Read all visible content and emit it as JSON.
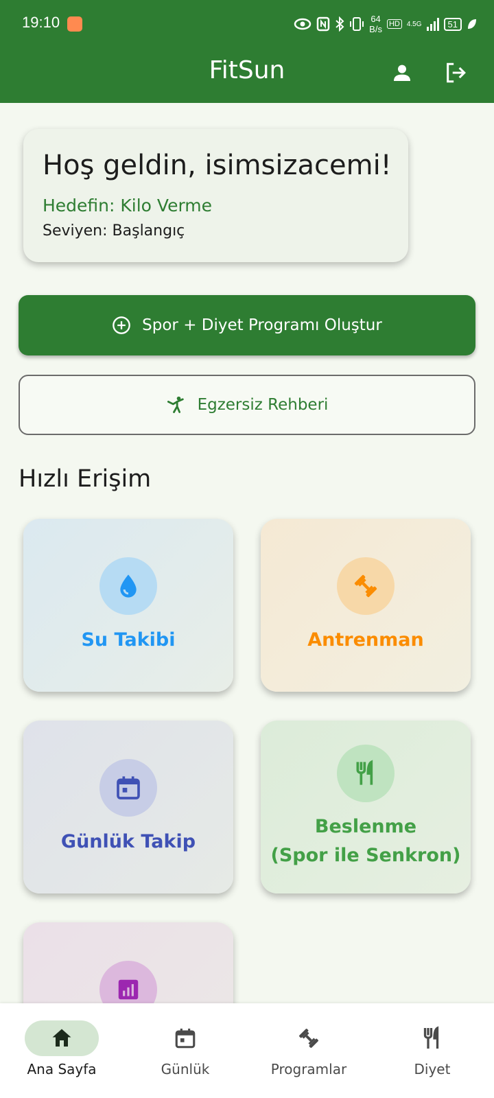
{
  "status_bar": {
    "time": "19:10",
    "net_speed_value": "64",
    "net_speed_unit": "B/s",
    "hd_label": "HD",
    "network_type": "4.5G",
    "battery": "51"
  },
  "app_bar": {
    "title": "FitSun",
    "profile_icon": "person-icon",
    "logout_icon": "logout-icon"
  },
  "welcome": {
    "greeting": "Hoş geldin, isimsizacemi!",
    "goal": "Hedefin: Kilo Verme",
    "level": "Seviyen: Başlangıç"
  },
  "actions": {
    "create_program_label": "Spor + Diyet Programı Oluştur",
    "create_program_icon": "add-circle-icon",
    "exercise_guide_label": "Egzersiz Rehberi",
    "exercise_guide_icon": "exercise-person-icon"
  },
  "quick_access": {
    "title": "Hızlı Erişim",
    "tiles": [
      {
        "label": "Su Takibi",
        "icon": "water-drop-icon",
        "color": "#2196f3",
        "bg": "#e1edf0"
      },
      {
        "label": "Antrenman",
        "icon": "dumbbell-icon",
        "color": "#fb8c00",
        "bg": "#f5ecd9"
      },
      {
        "label": "Günlük Takip",
        "icon": "calendar-icon",
        "color": "#3f51b5",
        "bg": "#e2e6ea"
      },
      {
        "label_line1": "Beslenme",
        "label_line2": "(Spor ile Senkron)",
        "icon": "restaurant-icon",
        "color": "#43a047",
        "bg": "#e0eedd"
      },
      {
        "label": "",
        "icon": "bar-chart-icon",
        "color": "#9c27b0",
        "bg": "#ece3e8"
      }
    ]
  },
  "bottom_nav": {
    "items": [
      {
        "label": "Ana Sayfa",
        "icon": "home-icon",
        "active": true
      },
      {
        "label": "Günlük",
        "icon": "calendar-icon",
        "active": false
      },
      {
        "label": "Programlar",
        "icon": "dumbbell-icon",
        "active": false
      },
      {
        "label": "Diyet",
        "icon": "restaurant-icon",
        "active": false
      }
    ]
  },
  "colors": {
    "primary": "#2e7d32",
    "background": "#f4f8f0"
  }
}
